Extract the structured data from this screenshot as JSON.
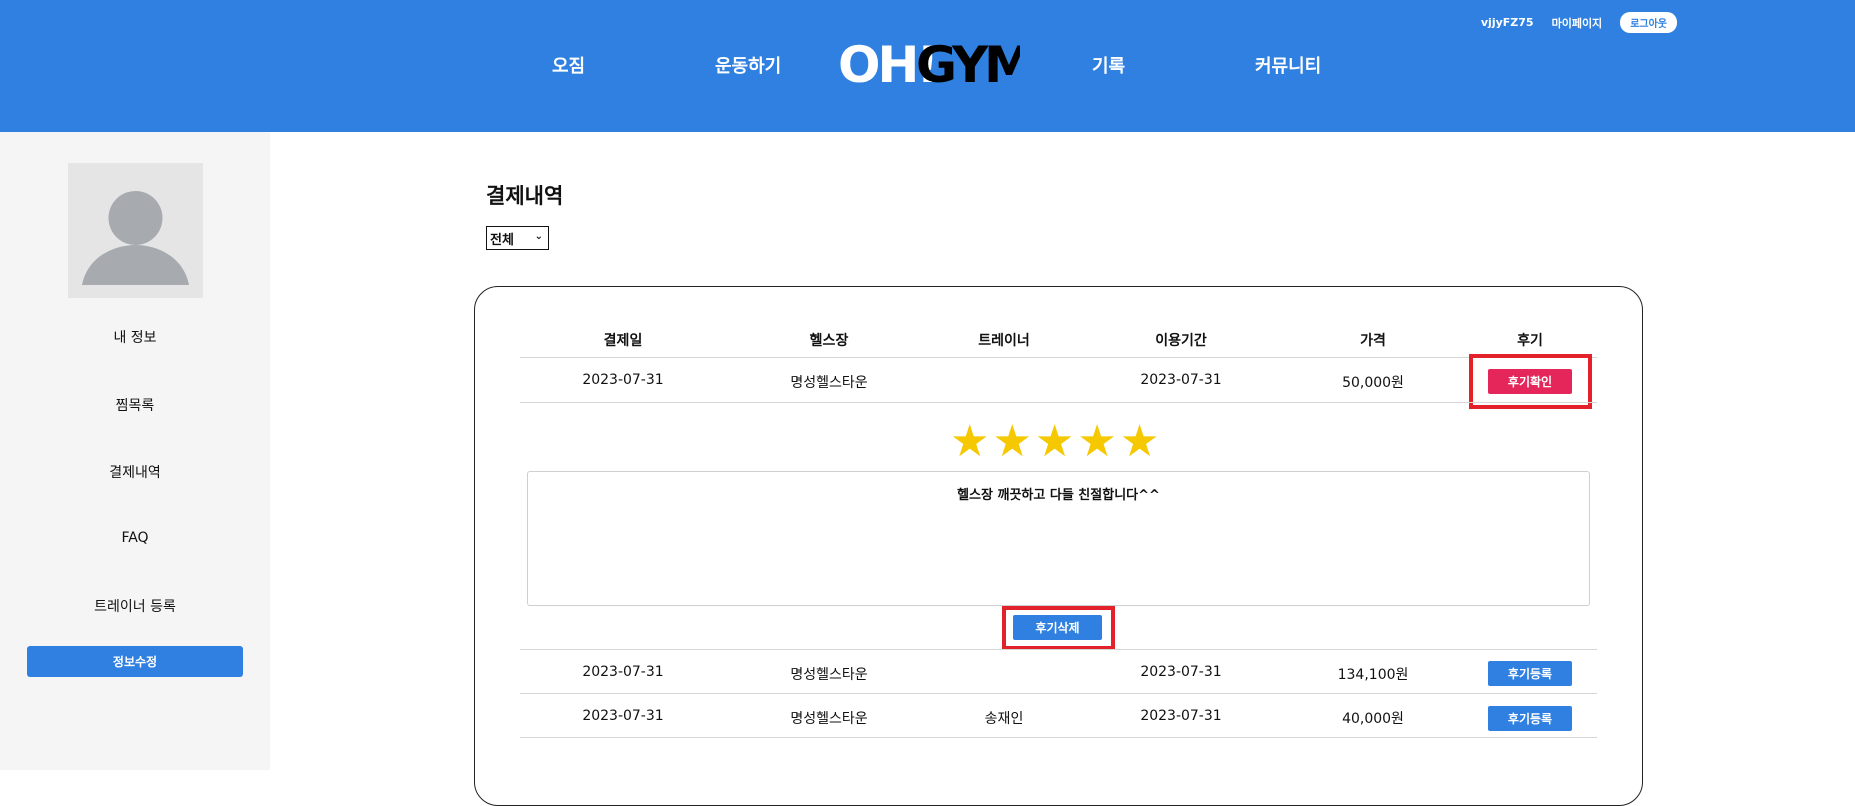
{
  "header": {
    "username": "vjjyFZ75",
    "mypage": "마이페이지",
    "logout": "로그아웃",
    "nav": [
      "오짐",
      "운동하기",
      "기록",
      "커뮤니티"
    ],
    "logo_text": "OH!GYM"
  },
  "sidebar": {
    "items": [
      "내 정보",
      "찜목록",
      "결제내역",
      "FAQ",
      "트레이너 등록"
    ],
    "edit_button": "정보수정"
  },
  "main": {
    "title": "결제내역",
    "filter_value": "전체",
    "columns": [
      "결제일",
      "헬스장",
      "트레이너",
      "이용기간",
      "가격",
      "후기"
    ],
    "rows": [
      {
        "date": "2023-07-31",
        "gym": "명성헬스타운",
        "trainer": "",
        "period": "2023-07-31",
        "price": "50,000원",
        "action": "후기확인"
      },
      {
        "date": "2023-07-31",
        "gym": "명성헬스타운",
        "trainer": "",
        "period": "2023-07-31",
        "price": "134,100원",
        "action": "후기등록"
      },
      {
        "date": "2023-07-31",
        "gym": "명성헬스타운",
        "trainer": "송재인",
        "period": "2023-07-31",
        "price": "40,000원",
        "action": "후기등록"
      }
    ],
    "review": {
      "rating": 5,
      "text": "헬스장 깨끗하고 다들 친절합니다^^",
      "delete_button": "후기삭제"
    }
  },
  "colors": {
    "header_bg": "#2f80e0",
    "review_confirm": "#e5265b",
    "highlight": "#e3212b",
    "star": "#f5c800"
  }
}
